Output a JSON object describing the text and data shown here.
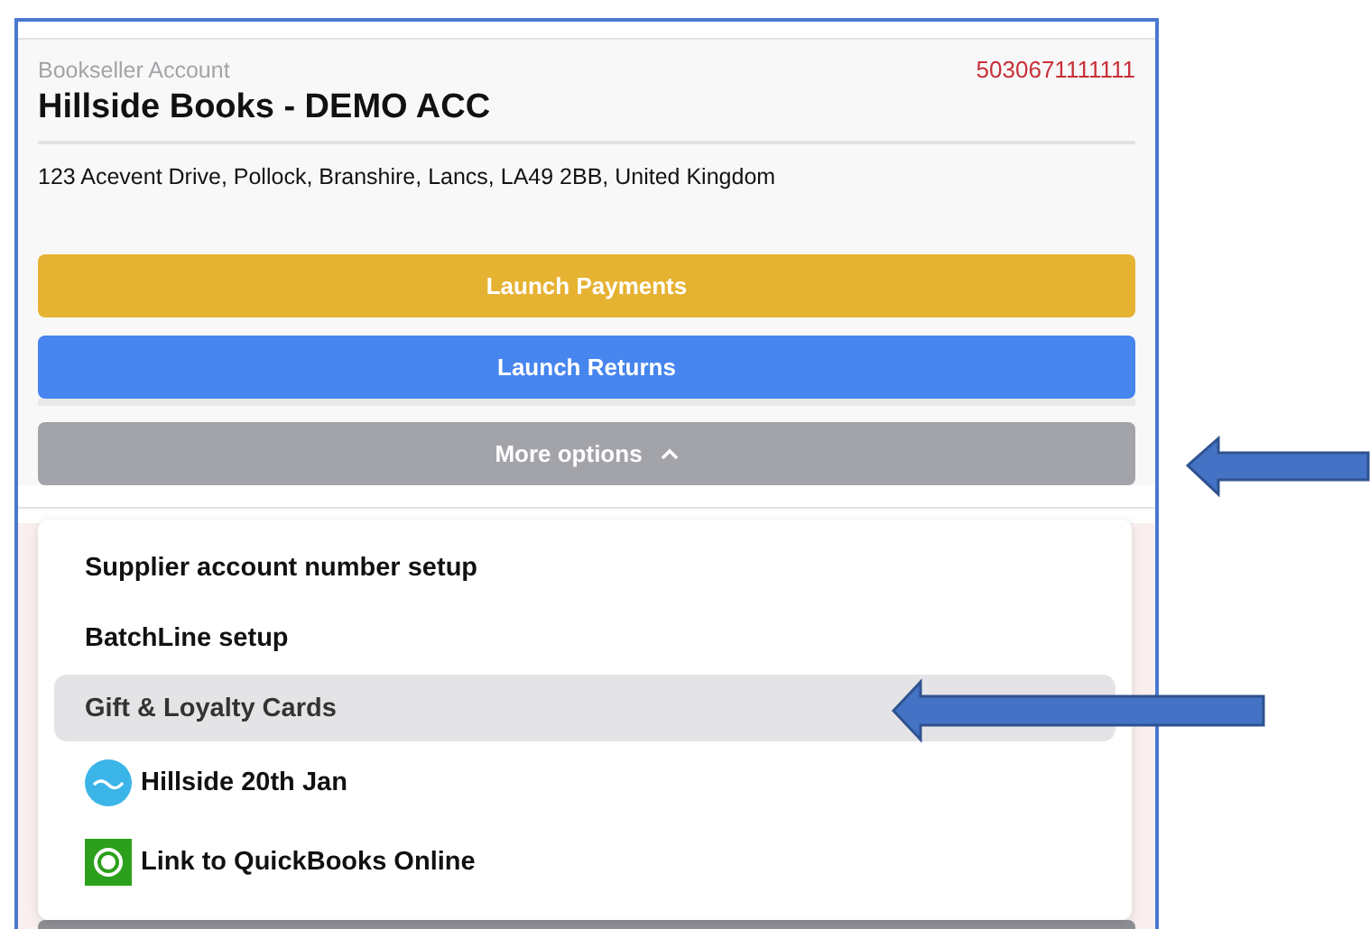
{
  "account": {
    "label": "Bookseller Account",
    "number": "5030671111111",
    "name": "Hillside Books - DEMO ACC",
    "address": "123 Acevent Drive, Pollock, Branshire, Lancs, LA49 2BB, United Kingdom"
  },
  "buttons": [
    {
      "label": "Launch Payments",
      "kind": "payments"
    },
    {
      "label": "Launch Returns",
      "kind": "returns"
    }
  ],
  "more_options": {
    "label": "More options",
    "expanded": true
  },
  "menu": [
    {
      "label": "Supplier account number setup",
      "kind": "plain",
      "selected": false
    },
    {
      "label": "BatchLine setup",
      "kind": "plain",
      "selected": false
    },
    {
      "label": "Gift & Loyalty Cards",
      "kind": "plain",
      "selected": true
    },
    {
      "label": "Hillside 20th Jan",
      "kind": "xero",
      "selected": false
    },
    {
      "label": "Link to QuickBooks Online",
      "kind": "quickbooks",
      "selected": false
    }
  ]
}
